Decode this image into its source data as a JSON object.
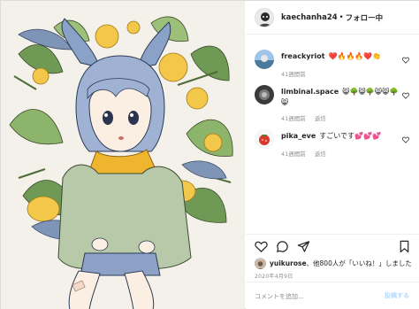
{
  "header": {
    "username": "kaechanha24",
    "separator": "•",
    "follow_label": "フォロー中"
  },
  "comments": [
    {
      "username": "freackyriot",
      "text": "❤️🔥🔥🔥❤️👏",
      "time": "41週間前",
      "reply_label": ""
    },
    {
      "username": "limbinal.space",
      "text": "😸🌳😸🌳😸😸🌳",
      "text2": "😸",
      "time": "41週間前",
      "reply_label": "返信"
    },
    {
      "username": "pika_eve",
      "text": "すごいです💕💕💕",
      "time": "41週間前",
      "reply_label": "返信"
    }
  ],
  "likes": {
    "user": "yuikurose",
    "rest": "、他800人が「いいね！」しました"
  },
  "date": "2020年4月9日",
  "add_comment": {
    "placeholder": "コメントを追加...",
    "post_label": "投稿する"
  },
  "icons": {
    "like": "heart-icon",
    "comment": "comment-icon",
    "share": "paper-plane-icon",
    "save": "bookmark-icon"
  }
}
